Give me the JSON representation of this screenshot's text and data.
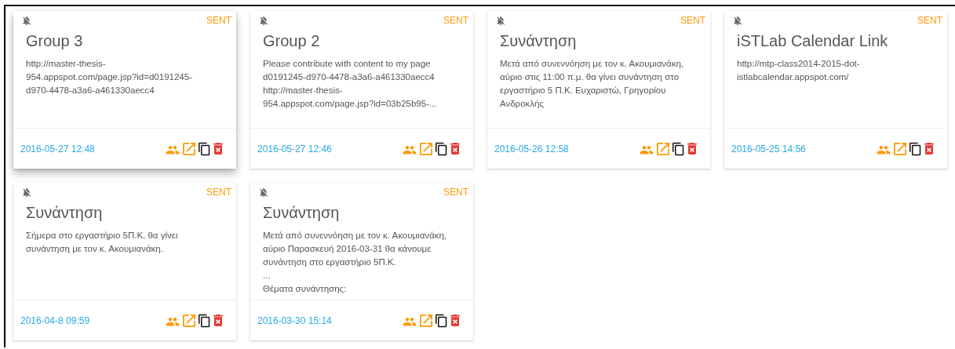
{
  "notes": [
    {
      "title": "Group 3",
      "status": "SENT",
      "raised": true,
      "body": "http://master-thesis-\n954.appspot.com/page.jsp?id=d0191245-\nd970-4478-a3a6-a461330aecc4",
      "date": "2016-05-27 12:48"
    },
    {
      "title": "Group 2",
      "status": "SENT",
      "raised": false,
      "body": "Please contribute with content to my page\nd0191245-d970-4478-a3a6-a461330aecc4\nhttp://master-thesis-\n954.appspot.com/page.jsp?id=03b25b95-...",
      "date": "2016-05-27 12:46"
    },
    {
      "title": "Συνάντηση",
      "status": "SENT",
      "raised": false,
      "body": "Μετά από συνεννόηση με τον κ. Ακουμιανάκη,\nαύριο στις 11:00 π.μ. θα γίνει συνάντηση στο\nεργαστήριο 5 Π.Κ. Ευχαριστώ, Γρηγορίου\nΑνδροκλής",
      "date": "2016-05-26 12:58"
    },
    {
      "title": "iSTLab Calendar Link",
      "status": "SENT",
      "raised": false,
      "body": "http://mtp-class2014-2015-dot-\nistlabcalendar.appspot.com/",
      "date": "2016-05-25 14:56"
    },
    {
      "title": "Συνάντηση",
      "status": "SENT",
      "raised": false,
      "body": "Σήμερα στο εργαστήριο 5Π.Κ. θα γίνει\nσυνάντηση με τον κ. Ακουμιανάκη.",
      "date": "2016-04-8 09:59"
    },
    {
      "title": "Συνάντηση",
      "status": "SENT",
      "raised": false,
      "body": "Μετά από συνεννόηση με τον κ. Ακουμιανάκη,\nαύριο Παρασκευή 2016-03-31 θα κάνουμε\nσυνάντηση στο εργαστήριο 5Π.Κ.\n...\nΘέματα συνάντησης:",
      "date": "2016-03-30 15:14"
    }
  ]
}
